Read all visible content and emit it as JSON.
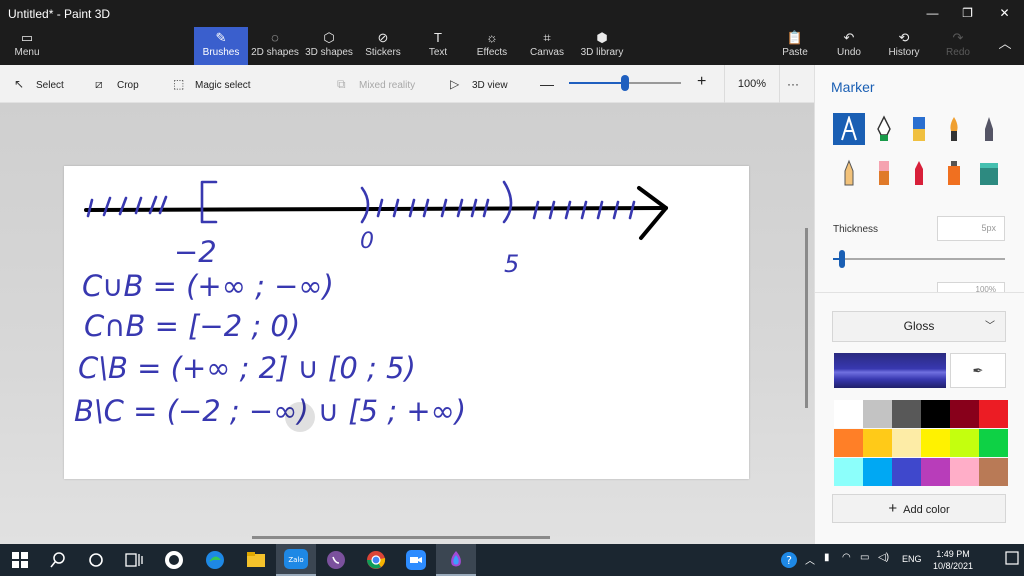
{
  "window": {
    "title": "Untitled* - Paint 3D"
  },
  "ribbon": {
    "menu_label": "Menu",
    "tabs": [
      "Brushes",
      "2D shapes",
      "3D shapes",
      "Stickers",
      "Text",
      "Effects",
      "Canvas",
      "3D library"
    ],
    "active_tab": "Brushes",
    "paste_label": "Paste",
    "undo_label": "Undo",
    "history_label": "History",
    "redo_label": "Redo"
  },
  "toolbar": {
    "select_label": "Select",
    "crop_label": "Crop",
    "magic_select_label": "Magic select",
    "mixed_reality_label": "Mixed reality",
    "view3d_label": "3D view",
    "zoom_value": "100%",
    "zoom_slider_fraction": 0.5,
    "more_label": "···"
  },
  "panel": {
    "title": "Marker",
    "tools": [
      "marker-icon",
      "calligraphy-pen-icon",
      "oil-brush-icon",
      "watercolor-icon",
      "pixel-pen-icon",
      "pencil-icon",
      "eraser-icon",
      "crayon-icon",
      "spray-can-icon",
      "fill-icon"
    ],
    "selected_tool": "marker-icon",
    "thickness_label": "Thickness",
    "thickness_value": "5px",
    "thickness_fraction": 0.05,
    "opacity_value": "100%",
    "finish_label": "Gloss",
    "current_color": "#3838b0",
    "palette": [
      "#ffffff",
      "#c3c3c3",
      "#585858",
      "#000000",
      "#88001b",
      "#ec1c24",
      "#ff7f27",
      "#ffca18",
      "#fdeca6",
      "#fff200",
      "#c4ff0e",
      "#0ed145",
      "#8cfffb",
      "#00a8f3",
      "#3f48cc",
      "#b83dba",
      "#ffaec8",
      "#b97a56"
    ],
    "add_color_label": "Add color"
  },
  "canvas": {
    "ink_color": "#3838b0",
    "labels": {
      "minus2": "−2",
      "zero": "0",
      "five": "5"
    },
    "lines": [
      "C∪B = (+∞ ; −∞)",
      "C∩B = [−2 ; 0)",
      "C\\B = (+∞ ; 2] ∪ [0 ; 5)",
      "B\\C = (−2 ; −∞) ∪ [5 ; +∞)"
    ]
  },
  "taskbar": {
    "clock_time": "1:49 PM",
    "clock_date": "10/8/2021",
    "language": "ENG"
  }
}
